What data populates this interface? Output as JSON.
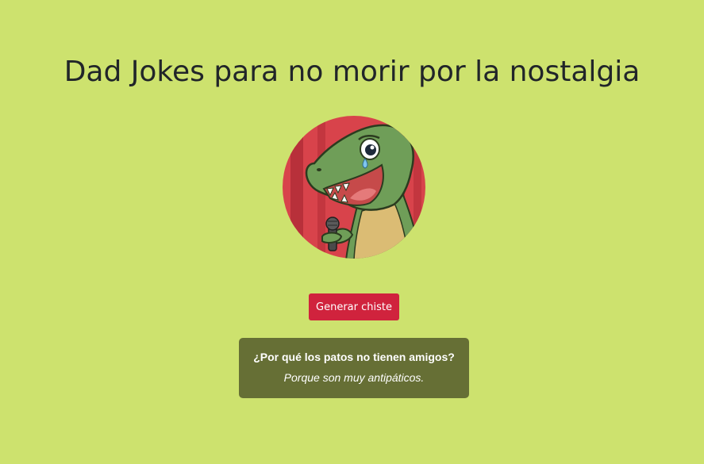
{
  "page": {
    "title": "Dad Jokes para no morir por la nostalgia",
    "background_color": "#cde26e"
  },
  "avatar": {
    "icon": "crying-trex-with-microphone-icon"
  },
  "actions": {
    "generate_label": "Generar chiste",
    "button_color": "#d0233d"
  },
  "joke": {
    "question": "¿Por qué los patos no tienen amigos?",
    "answer": "Porque son muy antipáticos.",
    "card_color": "#666f35"
  }
}
